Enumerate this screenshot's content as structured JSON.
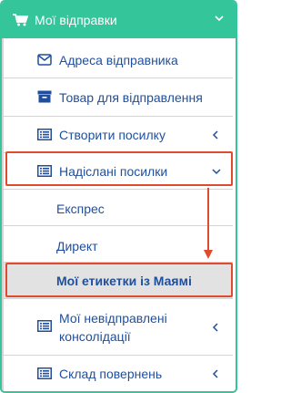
{
  "header": {
    "title": "Мої відправки",
    "icon": "cart-icon"
  },
  "menu": {
    "items": [
      {
        "label": "Адреса відправника",
        "icon": "envelope-icon"
      },
      {
        "label": "Товар для відправлення",
        "icon": "archive-box-icon"
      },
      {
        "label": "Створити посилку",
        "icon": "list-icon"
      },
      {
        "label": "Надіслані посилки",
        "icon": "list-icon"
      }
    ],
    "subitems": [
      {
        "label": "Експрес"
      },
      {
        "label": "Директ"
      },
      {
        "label": "Мої етикетки із Маямі"
      }
    ],
    "more": [
      {
        "label_line1": "Мої невідправлені",
        "label_line2": "консолідації",
        "icon": "list-icon"
      },
      {
        "label": "Склад повернень",
        "icon": "list-icon"
      }
    ]
  },
  "colors": {
    "accent": "#34c59b",
    "link": "#1f4f9c",
    "highlight": "#e04a2f",
    "active_bg": "#e2e2e2"
  }
}
